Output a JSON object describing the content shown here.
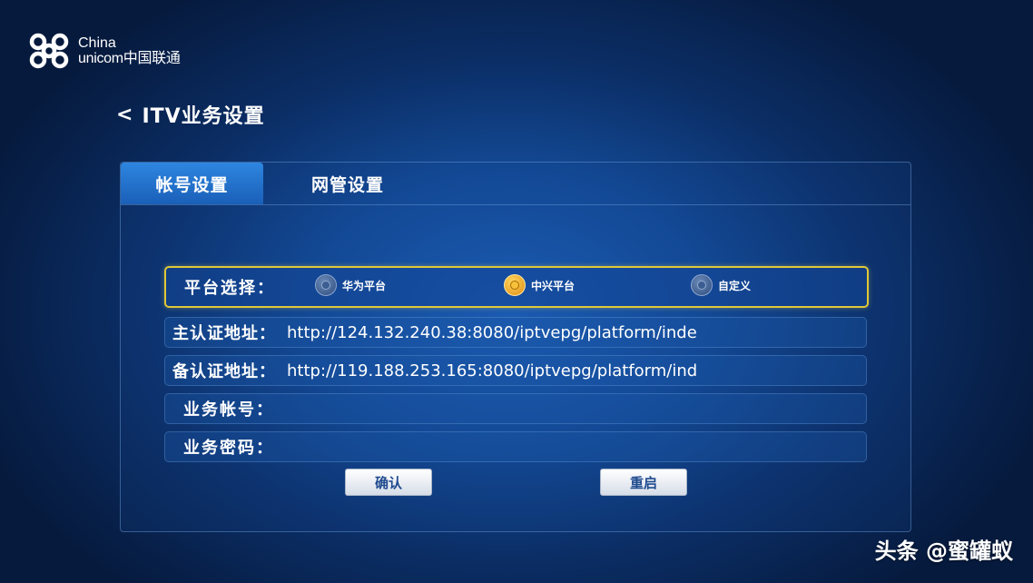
{
  "logo": {
    "line1": "China",
    "line2": "unicom中国联通"
  },
  "header": {
    "back": "<",
    "title": "ITV业务设置"
  },
  "tabs": [
    {
      "label": "帐号设置",
      "active": true
    },
    {
      "label": "网管设置",
      "active": false
    }
  ],
  "platform": {
    "label": "平台选择：",
    "options": [
      {
        "label": "华为平台",
        "selected": false
      },
      {
        "label": "中兴平台",
        "selected": true
      },
      {
        "label": "自定义",
        "selected": false
      }
    ]
  },
  "fields": {
    "primary_auth": {
      "label": "主认证地址：",
      "value": "http://124.132.240.38:8080/iptvepg/platform/inde"
    },
    "backup_auth": {
      "label": "备认证地址：",
      "value": "http://119.188.253.165:8080/iptvepg/platform/ind"
    },
    "account": {
      "label": "业务帐号：",
      "value": ""
    },
    "password": {
      "label": "业务密码：",
      "value": ""
    }
  },
  "buttons": {
    "confirm": "确认",
    "restart": "重启"
  },
  "watermark": "头条 @蜜罐蚁",
  "colors": {
    "highlight_border": "#e0c838",
    "tab_active": "#2e86e0",
    "button_text": "#1f4b8f"
  }
}
